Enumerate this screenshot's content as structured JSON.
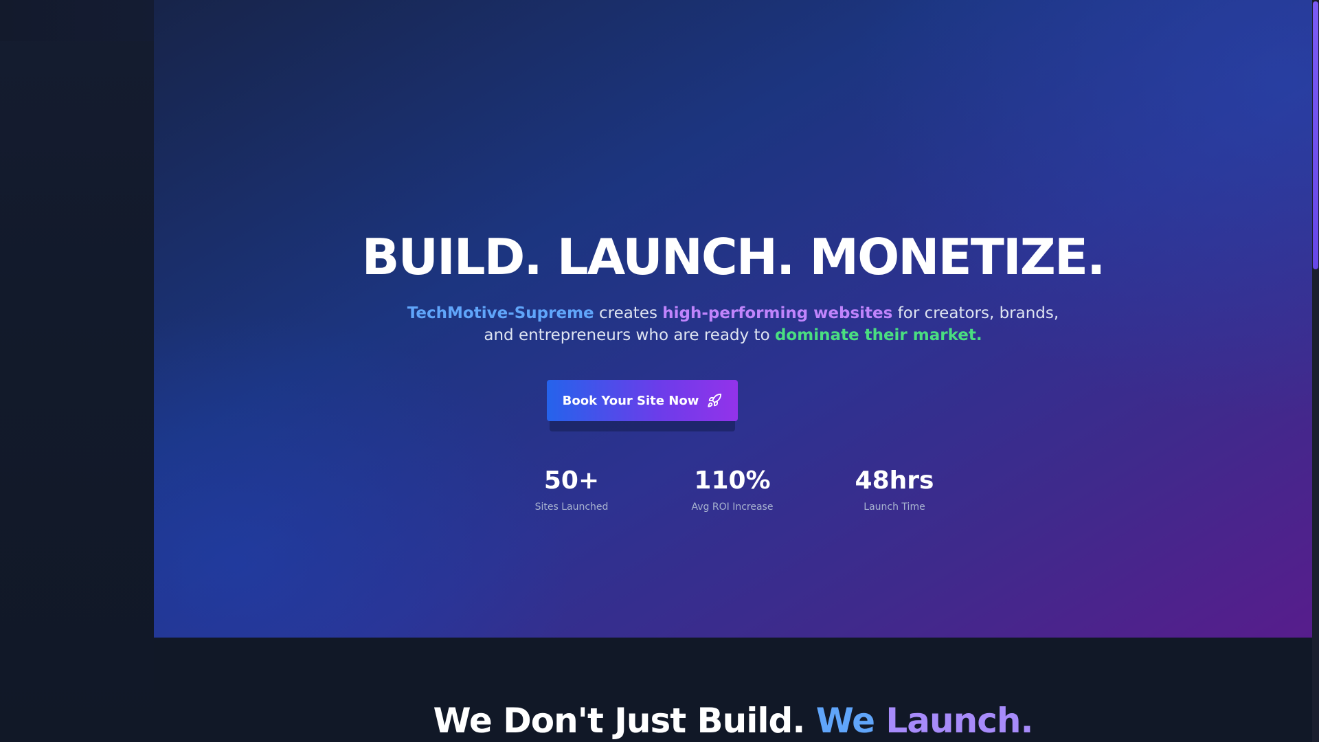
{
  "hero": {
    "title": "BUILD. LAUNCH. MONETIZE.",
    "subtitle": {
      "brand": "TechMotive-Supreme",
      "text_1": " creates ",
      "highlight": "high-performing websites",
      "text_2": " for creators, brands,",
      "text_3": "and entrepreneurs who are ready to ",
      "emphasis": "dominate their market."
    },
    "cta_label": "Book Your Site Now",
    "cta_icon": "rocket-icon"
  },
  "stats": [
    {
      "value": "50+",
      "label": "Sites Launched"
    },
    {
      "value": "110%",
      "label": "Avg ROI Increase"
    },
    {
      "value": "48hrs",
      "label": "Launch Time"
    }
  ],
  "section": {
    "title_part_1": "We Don't Just Build. ",
    "title_part_2": "We",
    "title_part_3": " Launch."
  },
  "colors": {
    "background": "#111827",
    "brand_blue": "#60a5fa",
    "highlight_purple": "#c084fc",
    "emphasis_green": "#4ade80",
    "cta_gradient_start": "#2563eb",
    "cta_gradient_end": "#9333ea",
    "scrollbar_thumb": "#7c5cf5"
  }
}
